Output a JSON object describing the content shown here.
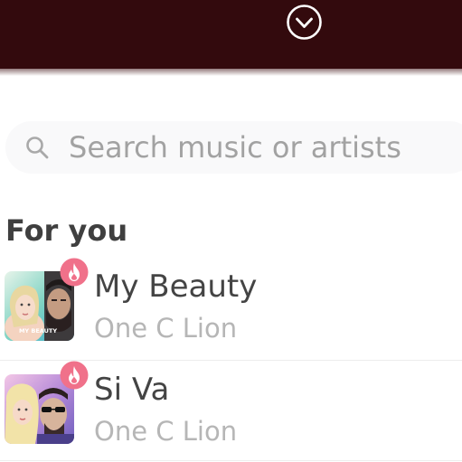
{
  "header": {
    "collapse_icon": "chevron-down-circle-icon",
    "background_color": "#330a0d"
  },
  "search": {
    "placeholder": "Search music or artists",
    "value": "",
    "icon": "search-icon"
  },
  "for_you": {
    "title": "For you",
    "songs": [
      {
        "title": "My Beauty",
        "artist": "One C Lion",
        "badge_icon": "flame-icon",
        "cover_text": "MY BEAUTY"
      },
      {
        "title": "Si Va",
        "artist": "One C Lion",
        "badge_icon": "flame-icon",
        "cover_text": ""
      }
    ]
  },
  "colors": {
    "accent_badge": "#f0718a",
    "title_text": "#444444",
    "artist_text": "#b6b6b6"
  }
}
